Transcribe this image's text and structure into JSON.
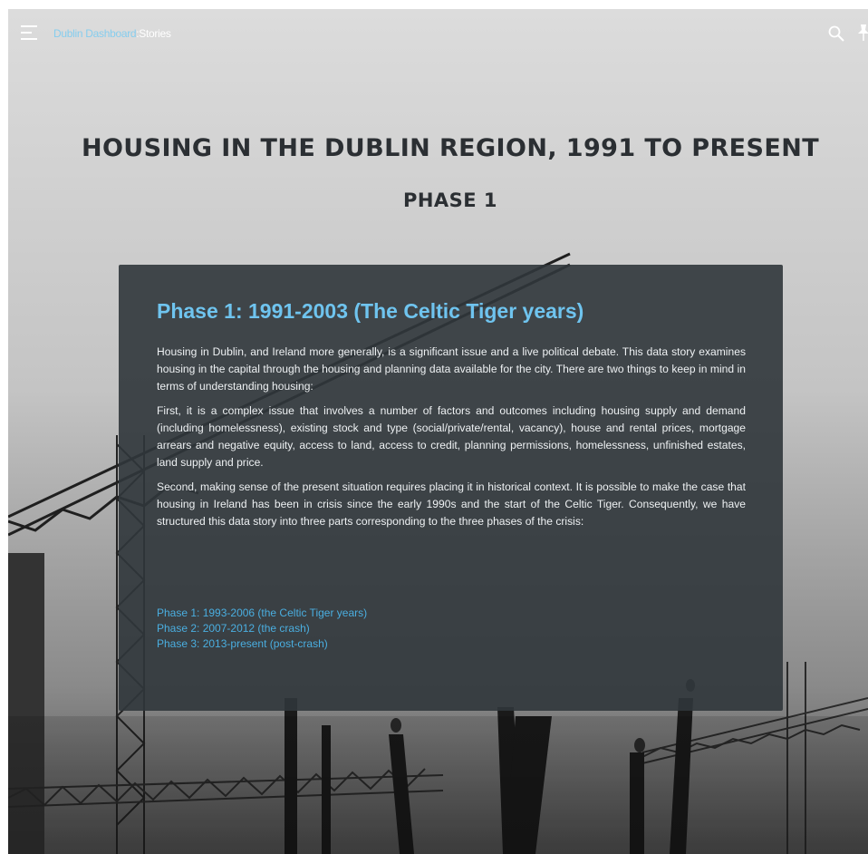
{
  "header": {
    "brand_name": "Dublin Dashboard",
    "brand_suffix": ":Stories",
    "menu_icon": "hamburger-menu-icon",
    "search_icon": "search-icon",
    "pin_icon": "pin-icon"
  },
  "hero": {
    "title": "HOUSING IN THE DUBLIN REGION, 1991 TO PRESENT",
    "subtitle": "PHASE 1"
  },
  "story": {
    "heading": "Phase 1: 1991-2003 (The Celtic Tiger years)",
    "paragraphs": [
      "Housing in Dublin, and Ireland more generally, is a significant issue and a live political debate. This data story examines housing in the capital through the housing and planning data available for the city. There are two things to keep in mind in terms of understanding housing:",
      "First, it is a complex issue that involves a number of factors and outcomes including housing supply and demand (including homelessness), existing stock and type (social/private/rental, vacancy), house and rental prices, mortgage arrears and negative equity, access to land, access to credit, planning permissions, homelessness, unfinished estates, land supply and price.",
      "Second, making sense of the present situation requires placing it in historical context. It is possible to make the case that housing in Ireland has been in crisis since the early 1990s and the start of the Celtic Tiger. Consequently, we have structured this data story into three parts corresponding to the three phases of the crisis:"
    ],
    "links": [
      "Phase 1: 1993-2006 (the Celtic Tiger years)",
      "Phase 2: 2007-2012 (the crash)",
      "Phase 3: 2013-present (post-crash)"
    ]
  },
  "colors": {
    "accent": "#6fc4ef",
    "link": "#4aaee0",
    "panel": "#30363b",
    "title": "#2b2f33"
  }
}
